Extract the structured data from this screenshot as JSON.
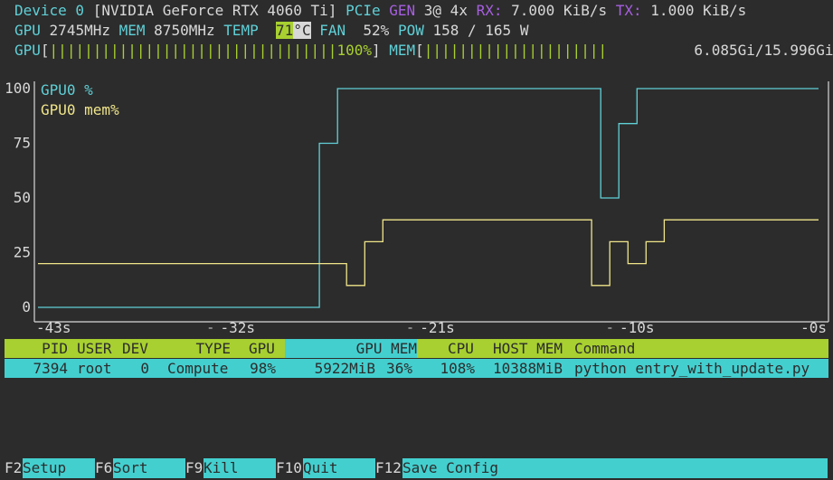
{
  "device": {
    "label": "Device 0",
    "name": "[NVIDIA GeForce RTX 4060 Ti]",
    "pcie_label": "PCIe",
    "gen_label": "GEN",
    "gen_value": "3@ 4x",
    "rx_label": "RX:",
    "rx_value": "7.000 KiB/s",
    "tx_label": "TX:",
    "tx_value": "1.000 KiB/s"
  },
  "stats": {
    "gpu_label": "GPU",
    "gpu_clock": "2745MHz",
    "mem_label": "MEM",
    "mem_clock": "8750MHz",
    "temp_label": "TEMP",
    "temp_value": "71",
    "temp_unit": "°C",
    "fan_label": "FAN",
    "fan_value": "52%",
    "pow_label": "POW",
    "pow_value": "158 / 165 W"
  },
  "bars": {
    "gpu_label": "GPU",
    "gpu_fill": "|||||||||||||||||||||||||||||||||",
    "gpu_percent": "100%",
    "gpu_value": 1.0,
    "mem_label": "MEM",
    "mem_fill": "|||||||||||||||||||||",
    "mem_used": "6.085Gi/15.996Gi",
    "mem_value": 0.38
  },
  "chart_data": {
    "type": "line",
    "xlim": [
      -43,
      0
    ],
    "ylim": [
      0,
      100
    ],
    "y_ticks": [
      {
        "value": 100,
        "label": "100"
      },
      {
        "value": 75,
        "label": "75"
      },
      {
        "value": 50,
        "label": "50"
      },
      {
        "value": 25,
        "label": "25"
      },
      {
        "value": 0,
        "label": "0"
      }
    ],
    "x_ticks": [
      {
        "value": -43,
        "label": "-43s"
      },
      {
        "value": -32,
        "label": "-32s"
      },
      {
        "value": -21,
        "label": "-21s"
      },
      {
        "value": -10,
        "label": "-10s"
      },
      {
        "value": 0,
        "label": "-0s"
      }
    ],
    "grid": false,
    "legend_placement": "top-left",
    "series": [
      {
        "name": "GPU0 %",
        "color": "#5fd0d7",
        "points": [
          [
            -43,
            0
          ],
          [
            -27.5,
            0
          ],
          [
            -27.5,
            75
          ],
          [
            -26.5,
            75
          ],
          [
            -26.5,
            100
          ],
          [
            -12,
            100
          ],
          [
            -12,
            50
          ],
          [
            -11,
            50
          ],
          [
            -11,
            84
          ],
          [
            -10,
            84
          ],
          [
            -10,
            100
          ],
          [
            0,
            100
          ]
        ]
      },
      {
        "name": "GPU0 mem%",
        "color": "#f0e58a",
        "points": [
          [
            -43,
            20
          ],
          [
            -26,
            20
          ],
          [
            -26,
            10
          ],
          [
            -25,
            10
          ],
          [
            -25,
            30
          ],
          [
            -24,
            30
          ],
          [
            -24,
            40
          ],
          [
            -12.5,
            40
          ],
          [
            -12.5,
            10
          ],
          [
            -11.5,
            10
          ],
          [
            -11.5,
            30
          ],
          [
            -10.5,
            30
          ],
          [
            -10.5,
            20
          ],
          [
            -9.5,
            20
          ],
          [
            -9.5,
            30
          ],
          [
            -8.5,
            30
          ],
          [
            -8.5,
            40
          ],
          [
            0,
            40
          ]
        ]
      }
    ]
  },
  "table": {
    "headers": {
      "pid": "PID",
      "user": "USER",
      "dev": "DEV",
      "type": "TYPE",
      "gpu": "GPU",
      "gpu_mem": "GPU MEM",
      "cpu": "CPU",
      "host_mem": "HOST MEM",
      "command": "Command"
    },
    "rows": [
      {
        "pid": "7394",
        "user": "root",
        "dev": "0",
        "type": "Compute",
        "gpu": "98%",
        "gpu_mem_mib": "5922MiB",
        "gpu_mem_pct": "36%",
        "cpu": "108%",
        "host_mem": "10388MiB",
        "command": "python entry_with_update.py"
      }
    ]
  },
  "footer": [
    {
      "key": "F2",
      "label": "Setup"
    },
    {
      "key": "F6",
      "label": "Sort"
    },
    {
      "key": "F9",
      "label": "Kill"
    },
    {
      "key": "F10",
      "label": "Quit"
    },
    {
      "key": "F12",
      "label": "Save Config"
    }
  ]
}
